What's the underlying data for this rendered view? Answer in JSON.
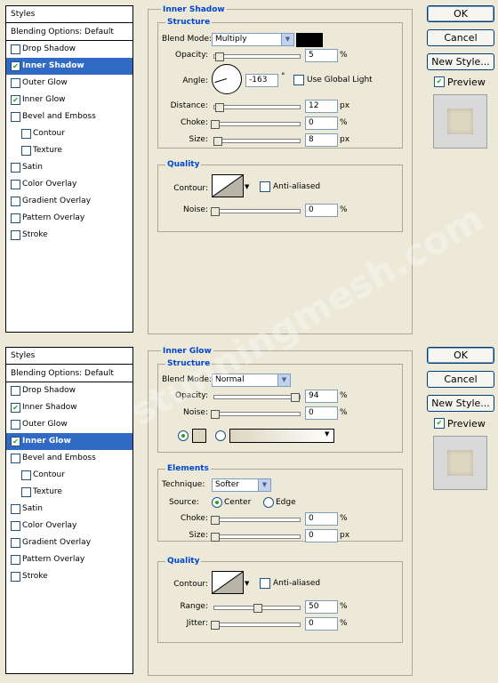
{
  "top": {
    "sidebar": {
      "styles_label": "Styles",
      "blending_label": "Blending Options: Default",
      "items": [
        {
          "label": "Drop Shadow",
          "checked": false,
          "selected": false,
          "sub": false
        },
        {
          "label": "Inner Shadow",
          "checked": true,
          "selected": true,
          "sub": false
        },
        {
          "label": "Outer Glow",
          "checked": false,
          "selected": false,
          "sub": false
        },
        {
          "label": "Inner Glow",
          "checked": true,
          "selected": false,
          "sub": false
        },
        {
          "label": "Bevel and Emboss",
          "checked": false,
          "selected": false,
          "sub": false
        },
        {
          "label": "Contour",
          "checked": false,
          "selected": false,
          "sub": true
        },
        {
          "label": "Texture",
          "checked": false,
          "selected": false,
          "sub": true
        },
        {
          "label": "Satin",
          "checked": false,
          "selected": false,
          "sub": false
        },
        {
          "label": "Color Overlay",
          "checked": false,
          "selected": false,
          "sub": false
        },
        {
          "label": "Gradient Overlay",
          "checked": false,
          "selected": false,
          "sub": false
        },
        {
          "label": "Pattern Overlay",
          "checked": false,
          "selected": false,
          "sub": false
        },
        {
          "label": "Stroke",
          "checked": false,
          "selected": false,
          "sub": false
        }
      ]
    },
    "title": "Inner Shadow",
    "structure_label": "Structure",
    "blend_mode_label": "Blend Mode:",
    "blend_mode_value": "Multiply",
    "shadow_color": "#000000",
    "opacity_label": "Opacity:",
    "opacity_value": "5",
    "opacity_fraction": 0.05,
    "angle_label": "Angle:",
    "angle_value": "-163",
    "angle_degrees": -163,
    "degree_symbol": "°",
    "global_light_label": "Use Global Light",
    "distance_label": "Distance:",
    "distance_value": "12",
    "distance_fraction": 0.05,
    "choke_label": "Choke:",
    "choke_value": "0",
    "choke_fraction": 0.0,
    "size_label": "Size:",
    "size_value": "8",
    "size_fraction": 0.03,
    "quality_label": "Quality",
    "contour_label": "Contour:",
    "anti_aliased_label": "Anti-aliased",
    "noise_label": "Noise:",
    "noise_value": "0",
    "noise_fraction": 0.0,
    "percent": "%",
    "px": "px"
  },
  "bottom": {
    "sidebar": {
      "styles_label": "Styles",
      "blending_label": "Blending Options: Default",
      "items": [
        {
          "label": "Drop Shadow",
          "checked": false,
          "selected": false,
          "sub": false
        },
        {
          "label": "Inner Shadow",
          "checked": true,
          "selected": false,
          "sub": false
        },
        {
          "label": "Outer Glow",
          "checked": false,
          "selected": false,
          "sub": false
        },
        {
          "label": "Inner Glow",
          "checked": true,
          "selected": true,
          "sub": false
        },
        {
          "label": "Bevel and Emboss",
          "checked": false,
          "selected": false,
          "sub": false
        },
        {
          "label": "Contour",
          "checked": false,
          "selected": false,
          "sub": true
        },
        {
          "label": "Texture",
          "checked": false,
          "selected": false,
          "sub": true
        },
        {
          "label": "Satin",
          "checked": false,
          "selected": false,
          "sub": false
        },
        {
          "label": "Color Overlay",
          "checked": false,
          "selected": false,
          "sub": false
        },
        {
          "label": "Gradient Overlay",
          "checked": false,
          "selected": false,
          "sub": false
        },
        {
          "label": "Pattern Overlay",
          "checked": false,
          "selected": false,
          "sub": false
        },
        {
          "label": "Stroke",
          "checked": false,
          "selected": false,
          "sub": false
        }
      ]
    },
    "title": "Inner Glow",
    "structure_label": "Structure",
    "blend_mode_label": "Blend Mode:",
    "blend_mode_value": "Normal",
    "opacity_label": "Opacity:",
    "opacity_value": "94",
    "opacity_fraction": 0.94,
    "noise_label": "Noise:",
    "noise_value": "0",
    "noise_fraction": 0.0,
    "glow_color": "#ddd6c0",
    "elements_label": "Elements",
    "technique_label": "Technique:",
    "technique_value": "Softer",
    "source_label": "Source:",
    "center_label": "Center",
    "edge_label": "Edge",
    "choke_label": "Choke:",
    "choke_value": "0",
    "choke_fraction": 0.0,
    "size_label": "Size:",
    "size_value": "0",
    "size_fraction": 0.0,
    "quality_label": "Quality",
    "contour_label": "Contour:",
    "anti_aliased_label": "Anti-aliased",
    "range_label": "Range:",
    "range_value": "50",
    "range_fraction": 0.5,
    "jitter_label": "Jitter:",
    "jitter_value": "0",
    "jitter_fraction": 0.0,
    "percent": "%",
    "px": "px"
  },
  "buttons": {
    "ok": "OK",
    "cancel": "Cancel",
    "new_style": "New Style...",
    "preview": "Preview"
  },
  "watermark": "stunningmesh.com"
}
